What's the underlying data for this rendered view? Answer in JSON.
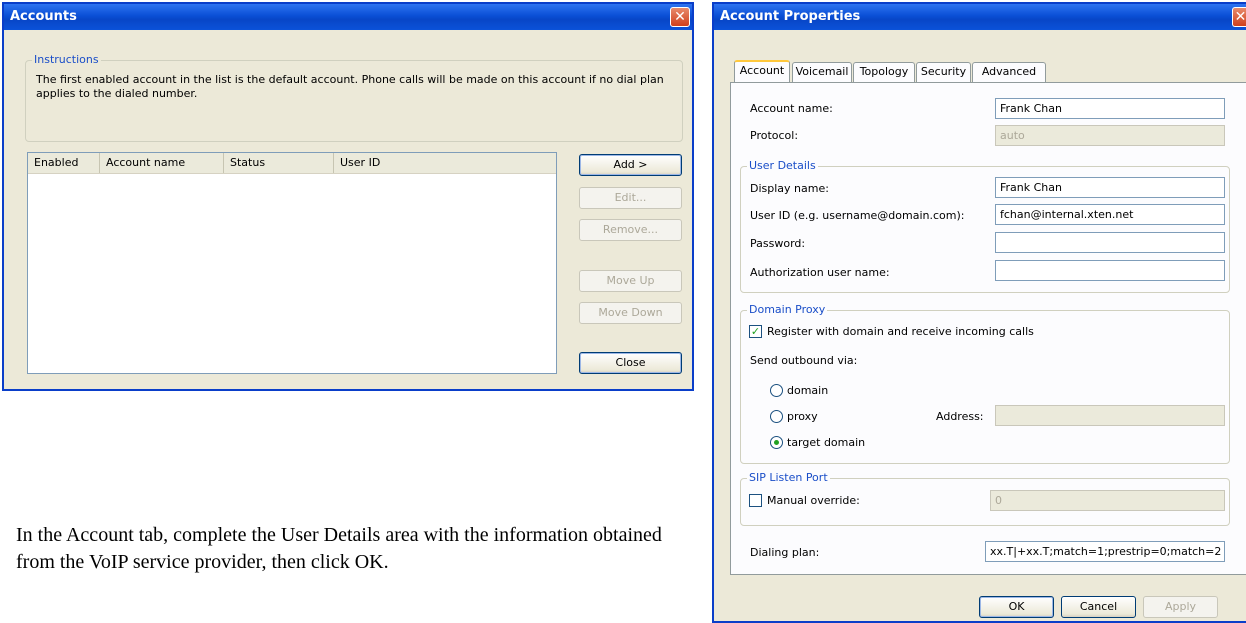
{
  "accounts_window": {
    "title": "Accounts",
    "close_glyph": "✕",
    "instructions_legend": "Instructions",
    "instructions_text": "The first enabled account in the list is the default account. Phone calls will be made on this account if no dial plan applies to the dialed number.",
    "columns": [
      "Enabled",
      "Account name",
      "Status",
      "User ID"
    ],
    "buttons": {
      "add": "Add >",
      "edit": "Edit...",
      "remove": "Remove...",
      "move_up": "Move Up",
      "move_down": "Move Down",
      "close": "Close"
    }
  },
  "caption": "In the Account tab, complete the User Details area with the information obtained from the VoIP service provider, then click OK.",
  "properties_window": {
    "title": "Account Properties",
    "close_glyph": "✕",
    "tabs": [
      "Account",
      "Voicemail",
      "Topology",
      "Security",
      "Advanced"
    ],
    "account_name_label": "Account name:",
    "account_name_value": "Frank Chan",
    "protocol_label": "Protocol:",
    "protocol_value": "auto",
    "user_details": {
      "legend": "User Details",
      "display_name_label": "Display name:",
      "display_name_value": "Frank Chan",
      "user_id_label": "User ID (e.g. username@domain.com):",
      "user_id_value": "fchan@internal.xten.net",
      "password_label": "Password:",
      "password_value": "",
      "auth_user_label": "Authorization user name:",
      "auth_user_value": ""
    },
    "domain_proxy": {
      "legend": "Domain Proxy",
      "register_label": "Register with domain and receive incoming calls",
      "register_checked": true,
      "send_outbound_label": "Send outbound via:",
      "radio_domain": "domain",
      "radio_proxy": "proxy",
      "radio_target": "target domain",
      "address_label": "Address:",
      "address_value": ""
    },
    "sip_listen_port": {
      "legend": "SIP Listen Port",
      "manual_override_label": "Manual override:",
      "manual_override_checked": false,
      "port_value": "0"
    },
    "dialing_plan_label": "Dialing plan:",
    "dialing_plan_value": "xx.T|+xx.T;match=1;prestrip=0;match=2",
    "buttons": {
      "ok": "OK",
      "cancel": "Cancel",
      "apply": "Apply"
    }
  }
}
